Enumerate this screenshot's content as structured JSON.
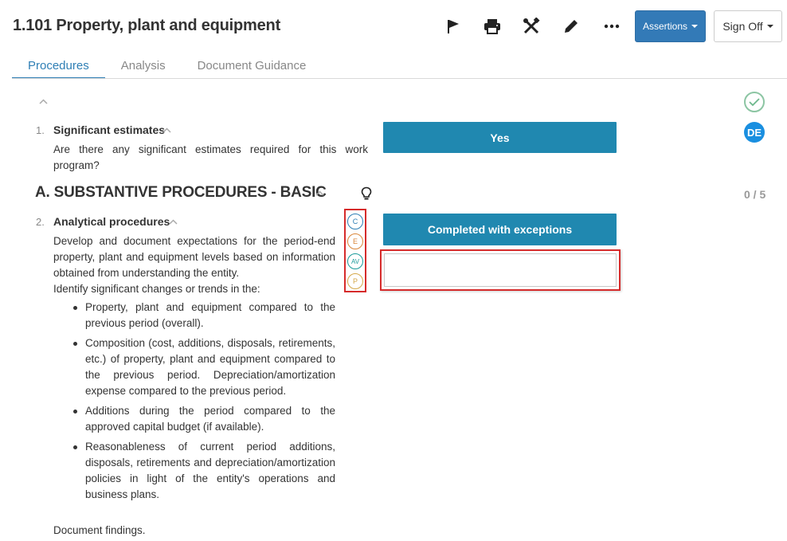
{
  "header": {
    "title": "1.101 Property, plant and equipment",
    "assertions_label": "Assertions",
    "signoff_label": "Sign Off"
  },
  "tabs": [
    {
      "label": "Procedures",
      "active": true
    },
    {
      "label": "Analysis",
      "active": false
    },
    {
      "label": "Document Guidance",
      "active": false
    }
  ],
  "signoff": {
    "initials": "DE",
    "status_icon": "check-circle-icon"
  },
  "items": [
    {
      "number": "1.",
      "title": "Significant estimates",
      "question": "Are there any significant estimates required for this work program?",
      "answer": "Yes"
    },
    {
      "number": "2.",
      "title": "Analytical procedures",
      "description": "Develop and document expectations for the period-end property, plant and equipment levels based on information obtained from understanding the entity.",
      "intro": "Identify significant changes or trends in the:",
      "bullets": [
        "Property, plant and equipment compared to the previous period (overall).",
        "Composition (cost, additions, disposals, retirements, etc.) of property, plant and equipment compared to the previous period. Depreciation/amortization expense compared to the previous period.",
        "Additions during the period compared to the approved capital budget (if available).",
        "Reasonableness of current period additions, disposals, retirements and depreciation/amortization policies in light of the entity's operations and business plans."
      ],
      "closing": "Document findings.",
      "answer": "Completed with exceptions",
      "findings_value": "",
      "assertions": [
        {
          "code": "C",
          "color": "#2f7fb5"
        },
        {
          "code": "E",
          "color": "#d9863a"
        },
        {
          "code": "AV",
          "color": "#1b9a9a"
        },
        {
          "code": "P",
          "color": "#d4a84a"
        }
      ]
    }
  ],
  "section": {
    "heading": "A. SUBSTANTIVE PROCEDURES - BASIC",
    "progress": "0 / 5"
  },
  "colors": {
    "accent": "#2088b0",
    "primary_button": "#337ab7",
    "highlight_border": "#d62b2b"
  }
}
